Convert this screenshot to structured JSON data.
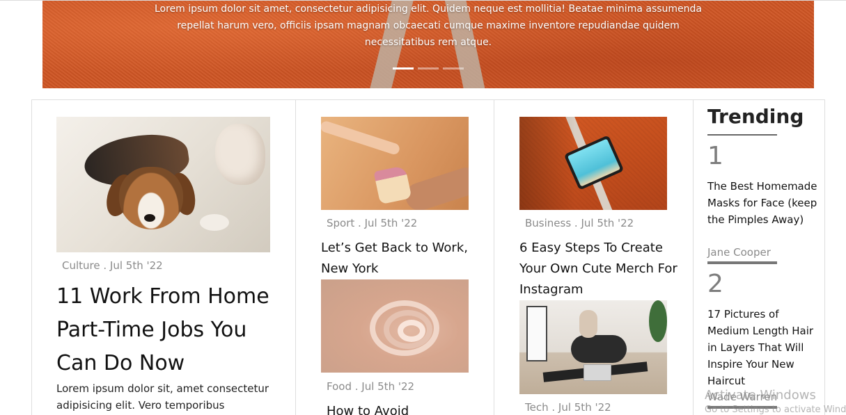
{
  "hero": {
    "text": "Lorem ipsum dolor sit amet, consectetur adipisicing elit. Quidem neque est mollitia! Beatae minima assumenda repellat harum vero, officiis ipsam magnam obcaecati cumque maxime inventore repudiandae quidem necessitatibus rem atque.",
    "slides_total": 3,
    "active_slide": 1
  },
  "featured": {
    "image_icon": "dog-photo",
    "meta": "Culture . Jul 5th '22",
    "title": " 11 Work From Home Part-Time Jobs You Can Do Now",
    "excerpt": "Lorem ipsum dolor sit, amet consectetur adipisicing elit. Vero temporibus"
  },
  "column2": {
    "posts": [
      {
        "image_icon": "cake-hands-photo",
        "meta": "Sport . Jul 5th '22",
        "title": " Let’s Get Back to Work, New York"
      },
      {
        "image_icon": "abstract-swirl-photo",
        "meta": "Food . Jul 5th '22",
        "title": "How to Avoid"
      }
    ]
  },
  "column3": {
    "posts": [
      {
        "image_icon": "tablet-track-photo",
        "meta": "Business . Jul 5th '22",
        "title": " 6 Easy Steps To Create Your Own Cute Merch For Instagram"
      },
      {
        "image_icon": "family-workout-photo",
        "meta": "Tech . Jul 5th '22"
      }
    ]
  },
  "trending": {
    "heading": "Trending",
    "items": [
      {
        "rank": "1",
        "title": "The Best Homemade Masks for Face (keep the Pimples Away)",
        "author": "Jane Cooper"
      },
      {
        "rank": "2",
        "title": "17 Pictures of Medium Length Hair in Layers That Will Inspire Your New Haircut",
        "author": "Wade Warren"
      }
    ]
  },
  "overlay": {
    "activate_title": "Activate Windows",
    "activate_sub": "Go to Settings to activate Windows."
  }
}
